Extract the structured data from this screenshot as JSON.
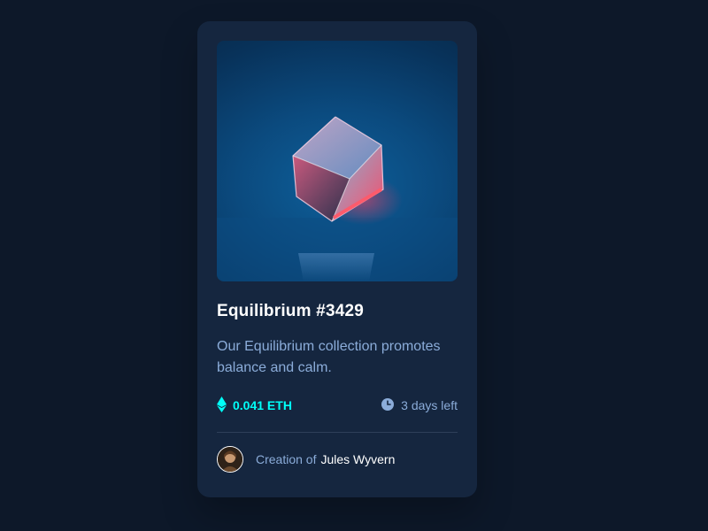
{
  "card": {
    "title": "Equilibrium #3429",
    "description": "Our Equilibrium collection promotes balance and calm.",
    "price": "0.041 ETH",
    "time_left": "3 days left",
    "creation_label": "Creation of",
    "creator_name": "Jules Wyvern"
  },
  "icons": {
    "price": "ethereum-icon",
    "time": "clock-icon",
    "art": "crystal-cube-image",
    "avatar": "creator-avatar"
  },
  "colors": {
    "page_bg": "#0d1829",
    "card_bg": "#15263f",
    "accent_cyan": "#00fff8",
    "soft_blue": "#8bacd9",
    "white": "#ffffff",
    "divider": "#2e405a"
  }
}
